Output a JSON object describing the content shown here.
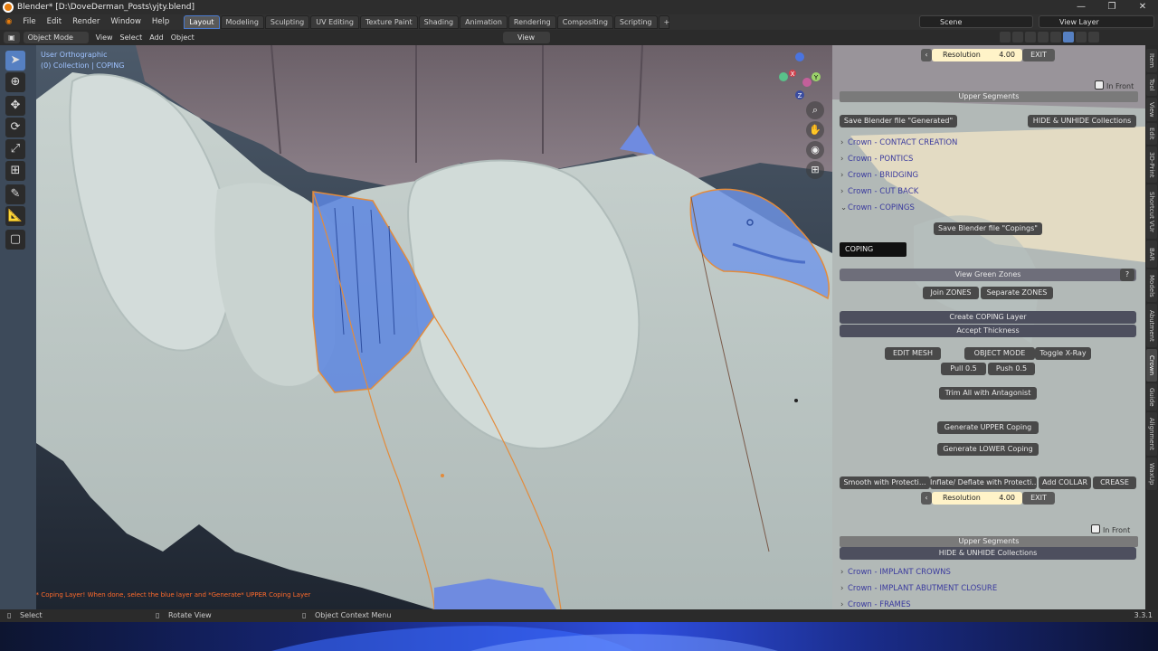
{
  "window": {
    "title": "Blender* [D:\\DoveDerman_Posts\\yjty.blend]",
    "controls": [
      "—",
      "❐",
      "✕"
    ]
  },
  "menu": [
    "File",
    "Edit",
    "Render",
    "Window",
    "Help"
  ],
  "workspaces": {
    "tabs": [
      "Layout",
      "Modeling",
      "Sculpting",
      "UV Editing",
      "Texture Paint",
      "Shading",
      "Animation",
      "Rendering",
      "Compositing",
      "Scripting"
    ],
    "active": "Layout",
    "add": "+"
  },
  "scene": {
    "label": "Scene"
  },
  "view_layer": {
    "label": "View Layer"
  },
  "header": {
    "mode": "Object Mode",
    "menus": [
      "View",
      "Select",
      "Add",
      "Object"
    ],
    "view_dropdown": "View"
  },
  "viewport": {
    "info_line1": "User Orthographic",
    "info_line2": "(0) Collection | COPING",
    "message": "*EDIT* Coping Layer! When done, select the blue layer and *Generate* UPPER Coping Layer",
    "tooltip": "COPING",
    "gizmo_axes": [
      "X",
      "Y",
      "Z"
    ]
  },
  "panel": {
    "resolution_label": "Resolution",
    "resolution_value": "4.00",
    "exit_label": "EXIT",
    "in_front_label": "In Front",
    "upper_segments_label": "Upper Segments",
    "save_generated_label": "Save Blender file \"Generated\"",
    "hide_unhide_label": "HIDE & UNHIDE Collections",
    "crown_rows": [
      {
        "label": "Crown - CONTACT CREATION",
        "open": false
      },
      {
        "label": "Crown - PONTICS",
        "open": false
      },
      {
        "label": "Crown - BRIDGING",
        "open": false
      },
      {
        "label": "Crown - CUT BACK",
        "open": false
      },
      {
        "label": "Crown - COPINGS",
        "open": true
      }
    ],
    "save_copings_label": "Save Blender file \"Copings\"",
    "view_green_zones_label": "View Green Zones",
    "join_zones_label": "Join ZONES",
    "separate_zones_label": "Separate ZONES",
    "create_coping_label": "Create COPING Layer",
    "accept_thickness_label": "Accept Thickness",
    "edit_mesh_label": "EDIT MESH",
    "object_mode_label": "OBJECT MODE",
    "toggle_xray_label": "Toggle X-Ray",
    "pull_label": "Pull 0.5",
    "push_label": "Push 0.5",
    "trim_label": "Trim All with Antagonist",
    "gen_upper_label": "Generate  UPPER Coping",
    "gen_lower_label": "Generate LOWER Coping",
    "smooth_label": "Smooth with Protecti...",
    "inflate_label": "Inflate/ Deflate with Protecti...",
    "add_collar_label": "Add COLLAR",
    "crease_label": "CREASE",
    "resolution2_value": "4.00",
    "upper_segments2_label": "Upper Segments",
    "hide_unhide2_label": "HIDE & UNHIDE Collections",
    "lower_rows": [
      {
        "label": "Crown - IMPLANT CROWNS"
      },
      {
        "label": "Crown - IMPLANT  ABUTMENT CLOSURE"
      },
      {
        "label": "Crown - FRAMES"
      }
    ]
  },
  "vertical_tabs": [
    "Item",
    "Tool",
    "View",
    "Edit",
    "3D-Print",
    "Shortcut VUr",
    "BAR",
    "Models",
    "Abutment",
    "Crown",
    "Guide",
    "Alignment",
    "WaxUp"
  ],
  "active_vertical_tab": "Crown",
  "status": {
    "select": "Select",
    "rotate": "Rotate View",
    "context": "Object Context Menu",
    "version": "3.3.1"
  }
}
